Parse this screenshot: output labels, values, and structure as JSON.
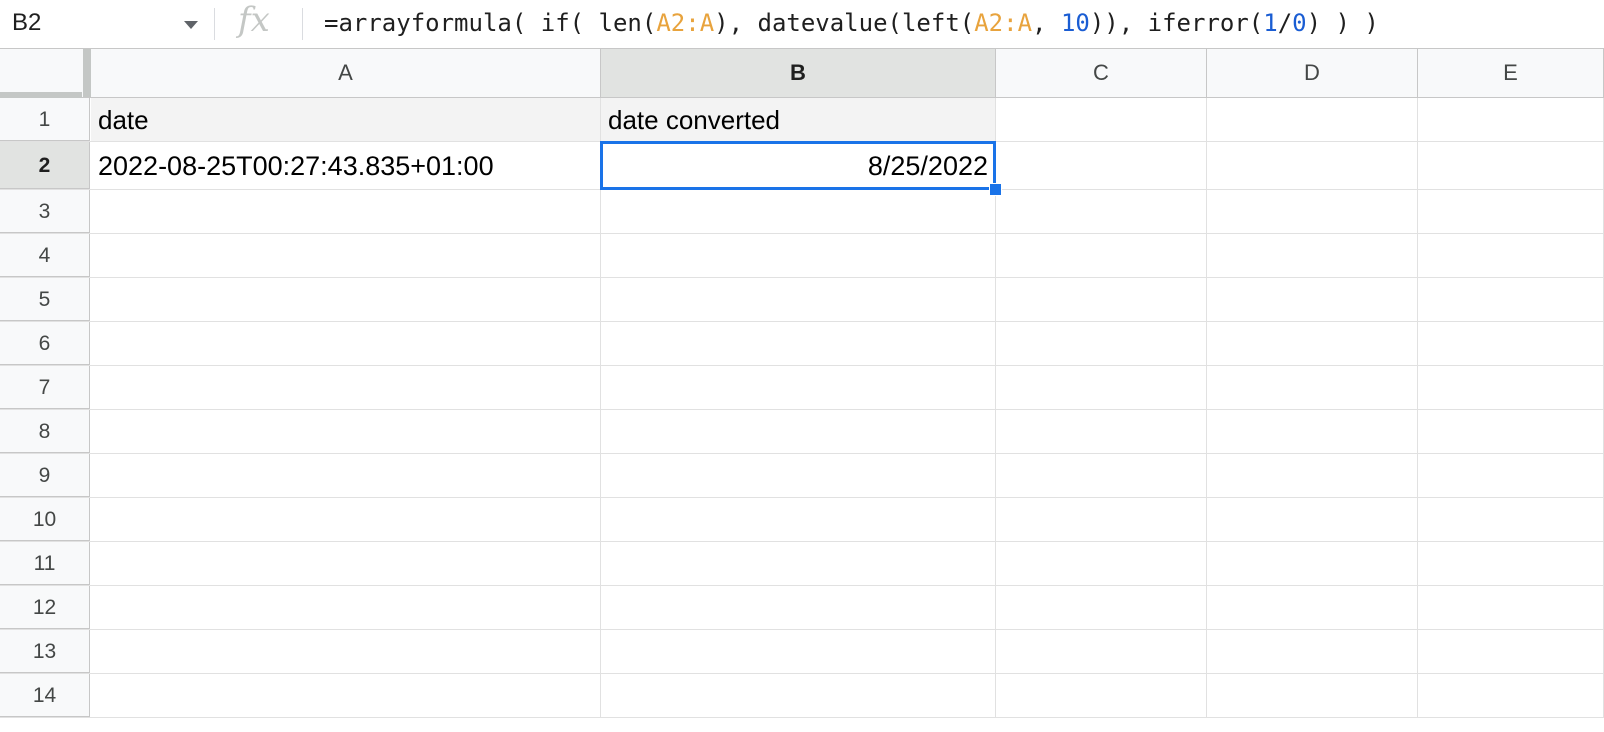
{
  "formula_bar": {
    "name_box": "B2",
    "fx_label": "fx",
    "formula_tokens": [
      {
        "text": "=arrayformula( if( len(",
        "kind": "plain"
      },
      {
        "text": "A2:A",
        "kind": "ref"
      },
      {
        "text": "), datevalue(left(",
        "kind": "plain"
      },
      {
        "text": "A2:A",
        "kind": "ref"
      },
      {
        "text": ", ",
        "kind": "plain"
      },
      {
        "text": "10",
        "kind": "num"
      },
      {
        "text": ")), iferror(",
        "kind": "plain"
      },
      {
        "text": "1",
        "kind": "num"
      },
      {
        "text": "/",
        "kind": "plain"
      },
      {
        "text": "0",
        "kind": "num"
      },
      {
        "text": ") ) )",
        "kind": "plain"
      }
    ]
  },
  "columns": [
    "A",
    "B",
    "C",
    "D",
    "E"
  ],
  "active_column": "B",
  "active_row": 2,
  "rows": [
    {
      "number": "1",
      "cells": [
        "date",
        "date converted",
        "",
        "",
        ""
      ]
    },
    {
      "number": "2",
      "cells": [
        "2022-08-25T00:27:43.835+01:00",
        "8/25/2022",
        "",
        "",
        ""
      ]
    },
    {
      "number": "3",
      "cells": [
        "",
        "",
        "",
        "",
        ""
      ]
    },
    {
      "number": "4",
      "cells": [
        "",
        "",
        "",
        "",
        ""
      ]
    },
    {
      "number": "5",
      "cells": [
        "",
        "",
        "",
        "",
        ""
      ]
    },
    {
      "number": "6",
      "cells": [
        "",
        "",
        "",
        "",
        ""
      ]
    },
    {
      "number": "7",
      "cells": [
        "",
        "",
        "",
        "",
        ""
      ]
    },
    {
      "number": "8",
      "cells": [
        "",
        "",
        "",
        "",
        ""
      ]
    },
    {
      "number": "9",
      "cells": [
        "",
        "",
        "",
        "",
        ""
      ]
    },
    {
      "number": "10",
      "cells": [
        "",
        "",
        "",
        "",
        ""
      ]
    },
    {
      "number": "11",
      "cells": [
        "",
        "",
        "",
        "",
        ""
      ]
    },
    {
      "number": "12",
      "cells": [
        "",
        "",
        "",
        "",
        ""
      ]
    },
    {
      "number": "13",
      "cells": [
        "",
        "",
        "",
        "",
        ""
      ]
    },
    {
      "number": "14",
      "cells": [
        "",
        "",
        "",
        "",
        ""
      ]
    }
  ],
  "colors": {
    "selection": "#1a73e8",
    "range_reference": "#e8a33d",
    "number_literal": "#1a5dd3",
    "header_row_fill": "#f3f3f3"
  }
}
